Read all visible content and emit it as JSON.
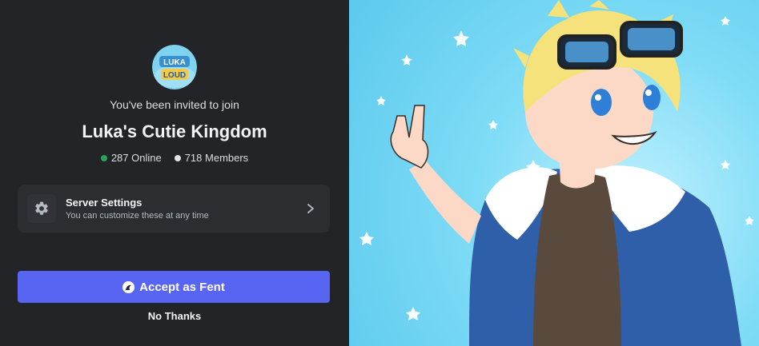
{
  "invite": {
    "label": "You've been invited to join",
    "guild_name": "Luka's Cutie Kingdom",
    "online_count": "287 Online",
    "member_count": "718 Members",
    "guild_icon_text_top": "LUKA",
    "guild_icon_text_bottom": "LOUD"
  },
  "settings": {
    "title": "Server Settings",
    "subtitle": "You can customize these at any time"
  },
  "actions": {
    "accept_label": "Accept as Fent",
    "decline_label": "No Thanks"
  },
  "colors": {
    "online": "#23a55a",
    "primary_button": "#5865f2",
    "panel_bg": "#232428",
    "settings_bg": "#2b2d31"
  }
}
